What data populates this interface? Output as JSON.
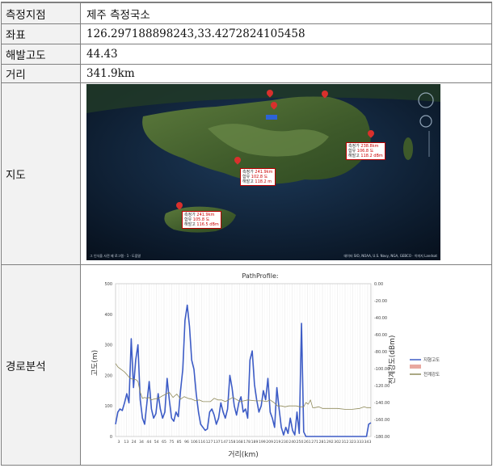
{
  "table": {
    "rows": [
      {
        "label": "측정지점",
        "value": "제주 측정국소"
      },
      {
        "label": "좌표",
        "value": "126.297188898243,33.4272824105458"
      },
      {
        "label": "해발고도",
        "value": "44.43"
      },
      {
        "label": "거리",
        "value": "341.9km"
      },
      {
        "label": "지도",
        "value": ""
      },
      {
        "label": "경로분석",
        "value": ""
      }
    ]
  },
  "map": {
    "callouts": [
      {
        "lines": [
          [
            "측정가",
            "241.9km"
          ],
          [
            "함유",
            "102.8 도"
          ],
          [
            "해발고",
            "118.2 m"
          ]
        ]
      },
      {
        "lines": [
          [
            "측정가",
            "238.8km"
          ],
          [
            "함유",
            "106.8 도"
          ],
          [
            "해발고",
            "118.2 dBm"
          ]
        ]
      },
      {
        "lines": [
          [
            "측정가",
            "241.9km"
          ],
          [
            "함유",
            "105.8 도"
          ],
          [
            "해발고",
            "116.5 dBm"
          ]
        ]
      }
    ],
    "footer_left": "그 인식을 사전 제 로그램 · 1 · 도움말",
    "footer_right": "데이터 SIO, NOAA, U.S. Navy, NGA, GEBCO · 이미지 Landsat"
  },
  "chart_data": {
    "type": "line",
    "title": "PathProfile:",
    "xlabel": "거리(km)",
    "ylabel_left": "고도(m)",
    "ylabel_right": "전계강도(dBm)",
    "x_tick_labels": [
      "3",
      "13",
      "24",
      "34",
      "44",
      "54",
      "65",
      "75",
      "85",
      "96",
      "106",
      "116",
      "127",
      "137",
      "147",
      "158",
      "168",
      "178",
      "189",
      "199",
      "209",
      "219",
      "230",
      "240",
      "250",
      "261",
      "271",
      "281",
      "292",
      "302",
      "312",
      "323",
      "333",
      "343"
    ],
    "ylim_left": [
      0,
      500
    ],
    "yticks_left": [
      "0",
      "100",
      "200",
      "300",
      "400",
      "500"
    ],
    "ylim_right": [
      -180,
      0
    ],
    "yticks_right": [
      "-180.00",
      "-160.00",
      "-140.00",
      "-120.00",
      "-100.00",
      "-80.00",
      "-60.00",
      "-40.00",
      "-20.00",
      "0.00"
    ],
    "grid": true,
    "legend_position": "right",
    "series": [
      {
        "name": "지형고도",
        "axis": "left",
        "color": "#3d5cc6",
        "x": [
          3,
          6,
          9,
          12,
          15,
          18,
          21,
          24,
          27,
          30,
          33,
          36,
          39,
          42,
          45,
          48,
          51,
          54,
          57,
          60,
          63,
          66,
          69,
          72,
          75,
          78,
          81,
          84,
          87,
          90,
          93,
          96,
          99,
          102,
          105,
          108,
          111,
          114,
          117,
          120,
          123,
          126,
          129,
          132,
          135,
          138,
          141,
          144,
          147,
          150,
          153,
          156,
          159,
          162,
          165,
          168,
          171,
          174,
          177,
          180,
          183,
          186,
          189,
          192,
          195,
          198,
          201,
          204,
          207,
          210,
          213,
          216,
          219,
          222,
          225,
          228,
          231,
          234,
          237,
          240,
          243,
          246,
          249,
          252,
          255,
          258,
          261,
          264,
          267,
          270,
          273,
          276,
          279,
          282,
          285,
          288,
          291,
          294,
          297,
          300,
          303,
          306,
          309,
          312,
          315,
          318,
          321,
          324,
          327,
          330,
          333,
          336,
          339,
          342,
          345
        ],
        "y": [
          40,
          80,
          90,
          85,
          110,
          140,
          110,
          320,
          160,
          250,
          300,
          120,
          60,
          40,
          110,
          180,
          90,
          60,
          75,
          140,
          90,
          60,
          80,
          190,
          120,
          60,
          50,
          80,
          65,
          150,
          220,
          380,
          430,
          360,
          250,
          220,
          140,
          80,
          40,
          30,
          20,
          25,
          80,
          90,
          70,
          40,
          60,
          110,
          80,
          60,
          90,
          200,
          160,
          100,
          70,
          110,
          130,
          80,
          90,
          60,
          250,
          280,
          170,
          120,
          80,
          100,
          150,
          120,
          190,
          80,
          60,
          30,
          160,
          90,
          30,
          5,
          30,
          10,
          60,
          20,
          5,
          80,
          10,
          370,
          15,
          0,
          0,
          0,
          0,
          0,
          0,
          0,
          0,
          0,
          0,
          0,
          0,
          0,
          0,
          0,
          0,
          0,
          0,
          0,
          0,
          0,
          0,
          0,
          0,
          0,
          0,
          0,
          0,
          40,
          45
        ]
      },
      {
        "name": "",
        "axis": "left",
        "color": "#e8a8a0",
        "x": [],
        "y": []
      },
      {
        "name": "전계강도",
        "axis": "right",
        "color": "#8f8a5a",
        "x": [
          3,
          6,
          9,
          12,
          15,
          18,
          21,
          24,
          30,
          33,
          36,
          39,
          42,
          45,
          48,
          51,
          54,
          60,
          66,
          75,
          80,
          85,
          90,
          95,
          100,
          105,
          110,
          115,
          120,
          125,
          130,
          135,
          140,
          145,
          150,
          160,
          170,
          180,
          190,
          200,
          205,
          210,
          215,
          220,
          225,
          230,
          235,
          240,
          245,
          250,
          255,
          258,
          261,
          264,
          267,
          270,
          275,
          280,
          285,
          290,
          300,
          310,
          320,
          330,
          333,
          336,
          339,
          342,
          345
        ],
        "y": [
          -94,
          -98,
          -100,
          -102,
          -104,
          -107,
          -110,
          -112,
          -113,
          -115,
          -128,
          -135,
          -134,
          -135,
          -134,
          -137,
          -136,
          -135,
          -132,
          -128,
          -134,
          -130,
          -136,
          -133,
          -135,
          -136,
          -138,
          -137,
          -139,
          -139,
          -139,
          -135,
          -137,
          -137,
          -139,
          -134,
          -139,
          -137,
          -138,
          -138,
          -139,
          -137,
          -140,
          -144,
          -144,
          -145,
          -144,
          -144,
          -144,
          -145,
          -145,
          -140,
          -142,
          -137,
          -146,
          -146,
          -145,
          -147,
          -147,
          -147,
          -147,
          -148,
          -148,
          -147,
          -146,
          -145,
          -146,
          -146,
          -146
        ]
      }
    ]
  }
}
